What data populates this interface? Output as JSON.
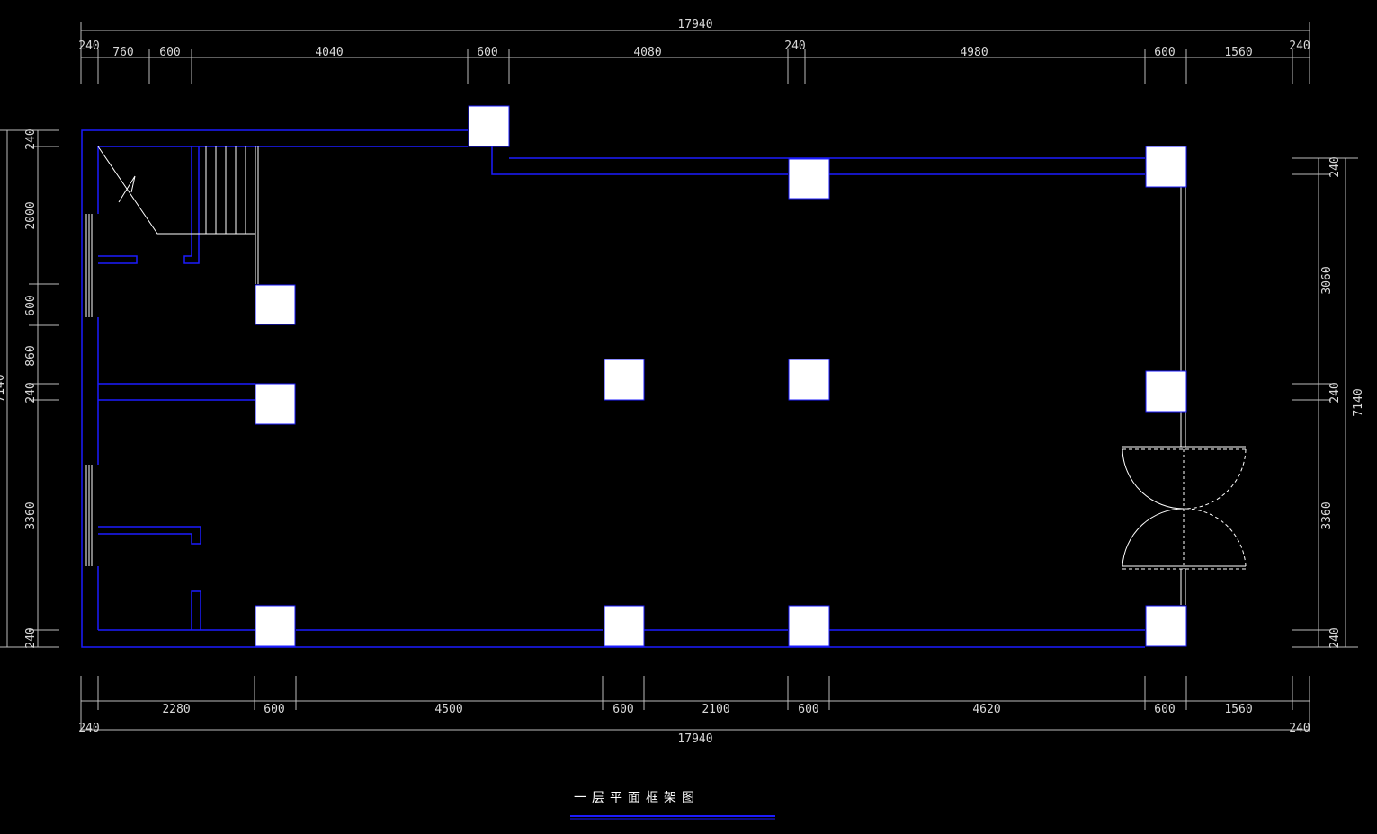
{
  "drawing": {
    "title": "一层平面框架图",
    "colors": {
      "background": "#000000",
      "walls": "#1c1cff",
      "dimensions": "#bdbdbd",
      "columns": "#ffffff"
    }
  },
  "dims": {
    "top_total": "17940",
    "top_240_left": "240",
    "top_760": "760",
    "top_600_a": "600",
    "top_4040": "4040",
    "top_600_b": "600",
    "top_4080": "4080",
    "top_240_mid": "240",
    "top_4980": "4980",
    "top_600_c": "600",
    "top_1560": "1560",
    "top_240_right": "240",
    "bot_2280": "2280",
    "bot_600_a": "600",
    "bot_4500": "4500",
    "bot_600_b": "600",
    "bot_2100": "2100",
    "bot_600_c": "600",
    "bot_4620": "4620",
    "bot_600_d": "600",
    "bot_1560": "1560",
    "bot_240_left": "240",
    "bot_total": "17940",
    "bot_240_right": "240",
    "left_240_top": "240",
    "left_2000": "2000",
    "left_600": "600",
    "left_860": "860",
    "left_240_mid": "240",
    "left_3360": "3360",
    "left_240_bot": "240",
    "left_total_partial": "7140",
    "right_240_top": "240",
    "right_3060": "3060",
    "right_240_mid": "240",
    "right_3360": "3360",
    "right_240_bot": "240",
    "right_total": "7140"
  }
}
